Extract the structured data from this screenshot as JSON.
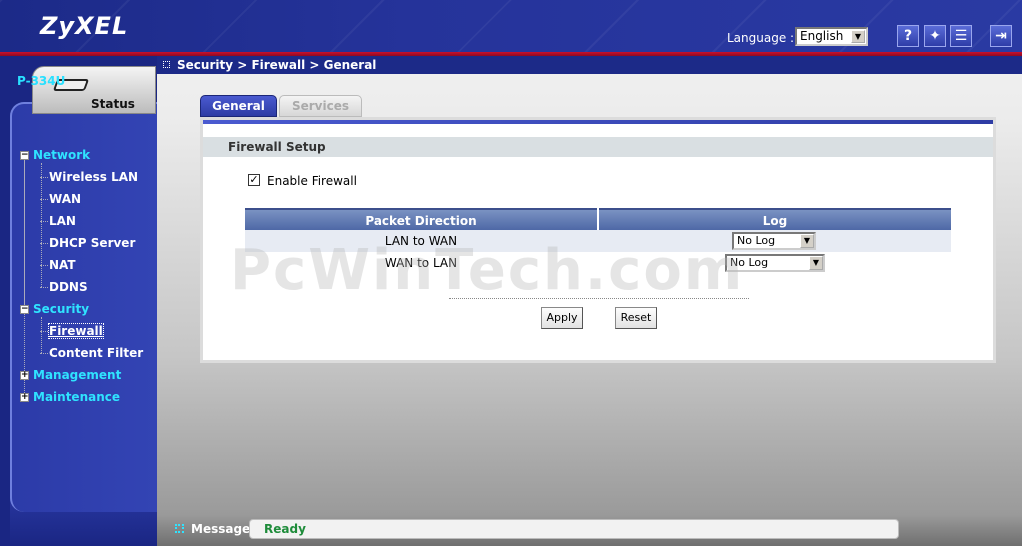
{
  "header": {
    "logo": "ZyXEL",
    "language_label": "Language :",
    "language_value": "English",
    "icons": [
      "help-icon",
      "wizard-icon",
      "sitemap-icon",
      "logout-icon"
    ]
  },
  "sidebar": {
    "status_tab": "Status",
    "device": "P-334U",
    "groups": [
      {
        "label": "Network",
        "expanded": true,
        "items": [
          "Wireless LAN",
          "WAN",
          "LAN",
          "DHCP Server",
          "NAT",
          "DDNS"
        ]
      },
      {
        "label": "Security",
        "expanded": true,
        "items": [
          "Firewall",
          "Content Filter"
        ]
      },
      {
        "label": "Management",
        "expanded": false
      },
      {
        "label": "Maintenance",
        "expanded": false
      }
    ],
    "active_item": "Firewall"
  },
  "breadcrumb": "Security > Firewall > General",
  "tabs": [
    {
      "label": "General",
      "active": true
    },
    {
      "label": "Services",
      "active": false
    }
  ],
  "firewall": {
    "section_title": "Firewall Setup",
    "enable_label": "Enable Firewall",
    "enable_checked": true,
    "columns": [
      "Packet Direction",
      "Log"
    ],
    "rows": [
      {
        "direction": "LAN to WAN",
        "log": "No Log"
      },
      {
        "direction": "WAN to LAN",
        "log": "No Log"
      }
    ]
  },
  "buttons": {
    "apply": "Apply",
    "reset": "Reset"
  },
  "watermark": "PcWinTech.com",
  "status_bar": {
    "label": "Message",
    "text": "Ready"
  },
  "colors": {
    "nav_cyan": "#2fe3ff",
    "header_blue": "#1c2a88",
    "ready_green": "#1e8c3a"
  }
}
